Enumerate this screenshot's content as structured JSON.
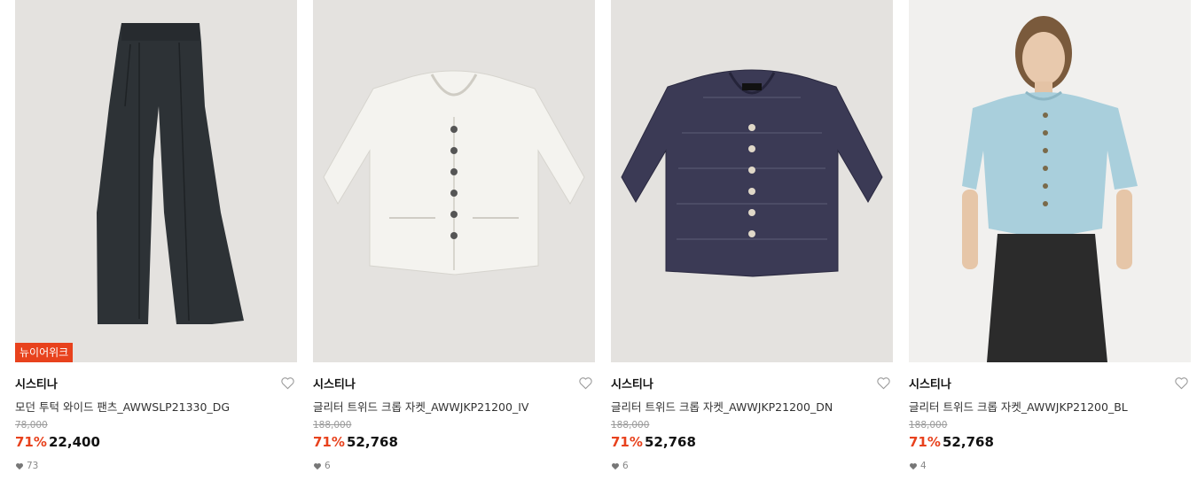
{
  "colors": {
    "accent": "#e8421d",
    "image_bg": "#e4e2df"
  },
  "products": [
    {
      "brand": "시스티나",
      "name": "모던 투턱 와이드 팬츠_AWWSLP21330_DG",
      "original_price": "78,000",
      "discount": "71%",
      "price": "22,400",
      "likes": "73",
      "badge": "뉴이어위크",
      "image": "charcoal-wide-pants"
    },
    {
      "brand": "시스티나",
      "name": "글리터 트위드 크롭 자켓_AWWJKP21200_IV",
      "original_price": "188,000",
      "discount": "71%",
      "price": "52,768",
      "likes": "6",
      "image": "ivory-tweed-jacket"
    },
    {
      "brand": "시스티나",
      "name": "글리터 트위드 크롭 자켓_AWWJKP21200_DN",
      "original_price": "188,000",
      "discount": "71%",
      "price": "52,768",
      "likes": "6",
      "image": "navy-tweed-jacket"
    },
    {
      "brand": "시스티나",
      "name": "글리터 트위드 크롭 자켓_AWWJKP21200_BL",
      "original_price": "188,000",
      "discount": "71%",
      "price": "52,768",
      "likes": "4",
      "image": "model-blue-tweed-jacket"
    }
  ]
}
